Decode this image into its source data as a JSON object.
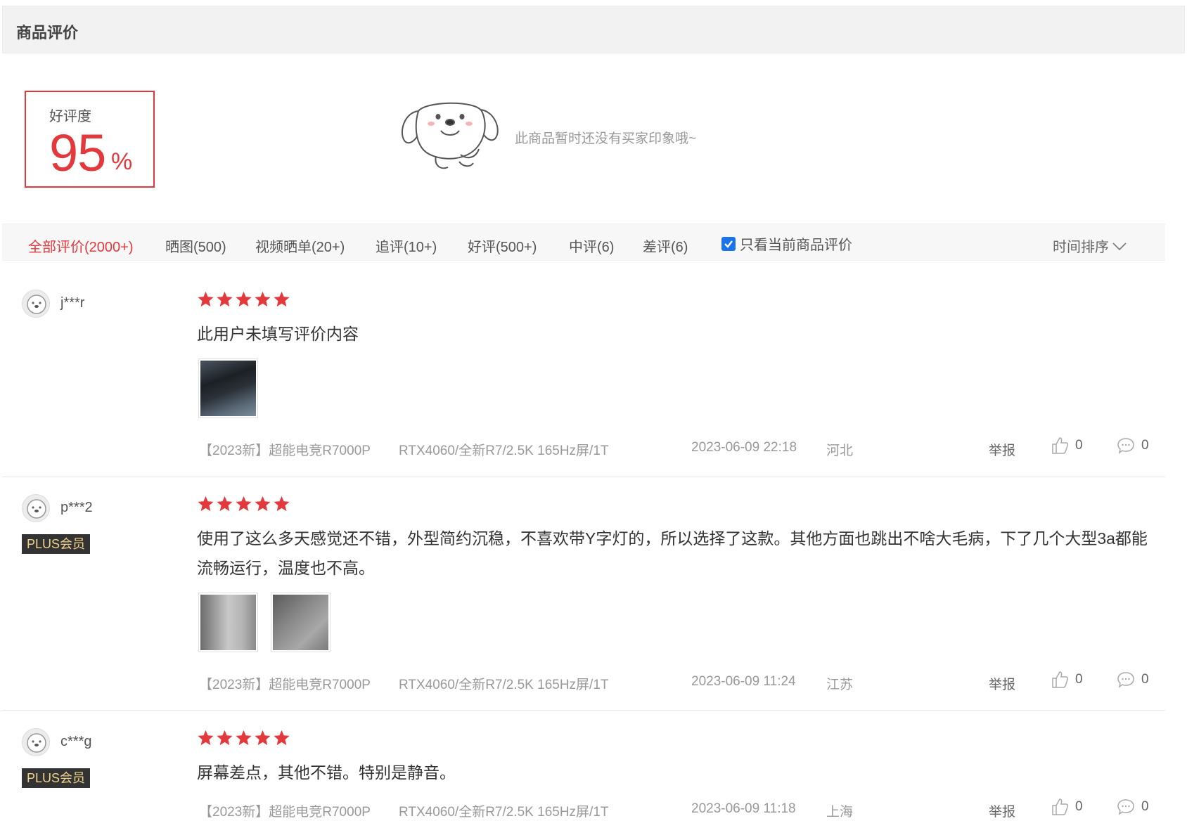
{
  "header": {
    "title": "商品评价"
  },
  "rating": {
    "label": "好评度",
    "value": "95",
    "unit": "%"
  },
  "impression": {
    "empty_text": "此商品暂时还没有买家印象哦~"
  },
  "filters": {
    "tabs": [
      {
        "label": "全部评价(2000+)",
        "active": true
      },
      {
        "label": "晒图(500)"
      },
      {
        "label": "视频晒单(20+)"
      },
      {
        "label": "追评(10+)"
      },
      {
        "label": "好评(500+)"
      },
      {
        "label": "中评(6)"
      },
      {
        "label": "差评(6)"
      }
    ],
    "only_current_label": "只看当前商品评价",
    "only_current_checked": true,
    "sort_label": "时间排序"
  },
  "reviews": [
    {
      "username": "j***r",
      "badge": "",
      "stars": 5,
      "content": "此用户未填写评价内容",
      "product": "【2023新】超能电竞R7000P",
      "variant": "RTX4060/全新R7/2.5K 165Hz屏/1T",
      "date": "2023-06-09 22:18",
      "location": "河北",
      "report_label": "举报",
      "likes": "0",
      "comments": "0"
    },
    {
      "username": "p***2",
      "badge": "PLUS会员",
      "stars": 5,
      "content": "使用了这么多天感觉还不错，外型简约沉稳，不喜欢带Y字灯的，所以选择了这款。其他方面也跳出不啥大毛病，下了几个大型3a都能流畅运行，温度也不高。",
      "product": "【2023新】超能电竞R7000P",
      "variant": "RTX4060/全新R7/2.5K 165Hz屏/1T",
      "date": "2023-06-09 11:24",
      "location": "江苏",
      "report_label": "举报",
      "likes": "0",
      "comments": "0"
    },
    {
      "username": "c***g",
      "badge": "PLUS会员",
      "stars": 5,
      "content": "屏幕差点，其他不错。特别是静音。",
      "product": "【2023新】超能电竞R7000P",
      "variant": "RTX4060/全新R7/2.5K 165Hz屏/1T",
      "date": "2023-06-09 11:18",
      "location": "上海",
      "report_label": "举报",
      "likes": "0",
      "comments": "0"
    }
  ],
  "colors": {
    "accent": "#e4393c",
    "plus_badge_bg": "#333333",
    "plus_badge_text": "#f0d48a"
  }
}
